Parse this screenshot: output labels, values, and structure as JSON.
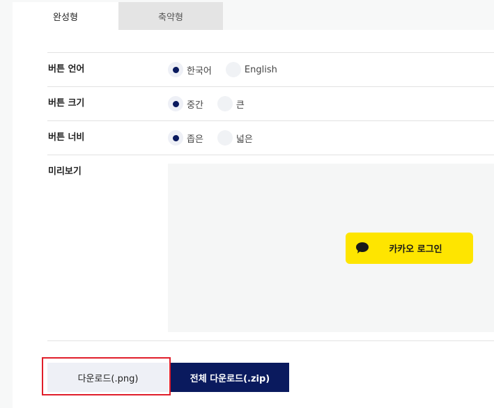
{
  "tabs": [
    {
      "label": "완성형",
      "active": true
    },
    {
      "label": "축약형",
      "active": false
    }
  ],
  "options": {
    "language": {
      "label": "버튼 언어",
      "choices": [
        {
          "label": "한국어",
          "checked": true
        },
        {
          "label": "English",
          "checked": false
        }
      ]
    },
    "size": {
      "label": "버튼 크기",
      "choices": [
        {
          "label": "중간",
          "checked": true
        },
        {
          "label": "큰",
          "checked": false
        }
      ]
    },
    "width": {
      "label": "버튼 너비",
      "choices": [
        {
          "label": "좁은",
          "checked": true
        },
        {
          "label": "넓은",
          "checked": false
        }
      ]
    }
  },
  "preview": {
    "label": "미리보기",
    "kakao_button_label": "카카오 로그인"
  },
  "actions": {
    "download_png": "다운로드(.png)",
    "download_all_zip": "전체 다운로드(.zip)"
  },
  "colors": {
    "accent_navy": "#0a1a5e",
    "kakao_yellow": "#fee500",
    "highlight_red": "#e01e2a"
  },
  "icons": {
    "kakao": "speech-bubble-icon"
  }
}
